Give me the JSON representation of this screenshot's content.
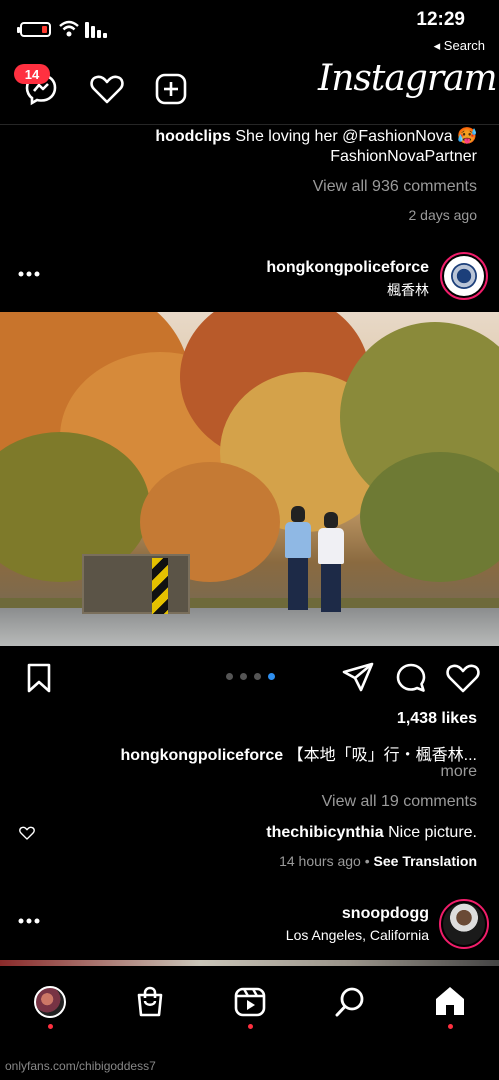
{
  "status_bar": {
    "time": "12:29",
    "back_label": "◂ Search"
  },
  "header": {
    "logo_text": "Instagram",
    "messages_badge": "14"
  },
  "prev_post": {
    "caption_user": "hoodclips",
    "caption_text_1": "She loving her @FashionNova 🥵",
    "caption_text_2": "FashionNovaPartner",
    "view_comments": "View all 936 comments",
    "time_ago": "2 days ago"
  },
  "post": {
    "username": "hongkongpoliceforce",
    "location": "楓香林",
    "likes": "1,438 likes",
    "caption_user": "hongkongpoliceforce",
    "caption_text": "【本地「吸」行・楓香林...",
    "more_label": "more",
    "view_comments": "View all 19 comments",
    "comment_user": "thechibicynthia",
    "comment_text": "Nice picture.",
    "time_ago": "14 hours ago",
    "see_translation": "See Translation",
    "carousel_count": 4,
    "carousel_active": 4
  },
  "next_post": {
    "username": "snoopdogg",
    "location": "Los Angeles, California"
  },
  "watermark": "onlyfans.com/chibigoddess7",
  "colors": {
    "badge": "#ff3040",
    "story_ring": "#f01d6a",
    "active_dot": "#2e8ff0"
  }
}
